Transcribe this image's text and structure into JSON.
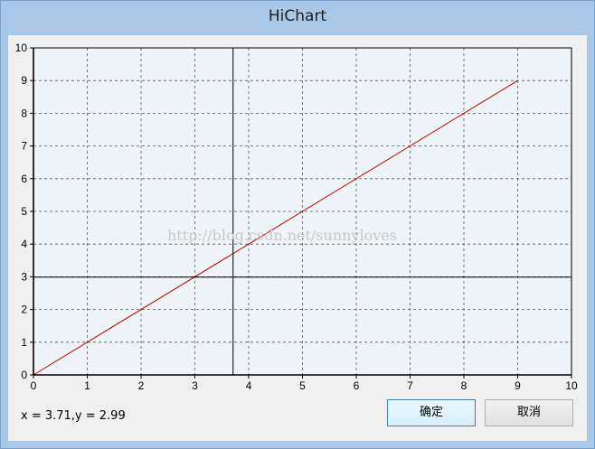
{
  "window": {
    "title": "HiChart"
  },
  "chart_data": {
    "type": "line",
    "title": "",
    "xlabel": "",
    "ylabel": "",
    "xlim": [
      0,
      10
    ],
    "ylim": [
      0,
      10
    ],
    "x_ticks": [
      "0",
      "1",
      "2",
      "3",
      "4",
      "5",
      "6",
      "7",
      "8",
      "9",
      "10"
    ],
    "y_ticks": [
      "0",
      "1",
      "2",
      "3",
      "4",
      "5",
      "6",
      "7",
      "8",
      "9",
      "10"
    ],
    "grid": true,
    "grid_style": "dashed",
    "plot_background": "#eef4f7",
    "series": [
      {
        "x": [
          0,
          9
        ],
        "y": [
          0,
          9
        ],
        "color": "#c00000"
      }
    ],
    "crosshair": {
      "x": 3.71,
      "y": 2.99,
      "color": "#000000"
    },
    "watermark": "http://blog.csdn.net/sunnyloves"
  },
  "status": {
    "readout": "x = 3.71,y = 2.99"
  },
  "buttons": {
    "ok_label": "确定",
    "cancel_label": "取消"
  },
  "colors": {
    "window_frame": "#a9c8e8",
    "client_bg": "#f0f0f0",
    "axis": "#000000",
    "grid": "#555555"
  }
}
